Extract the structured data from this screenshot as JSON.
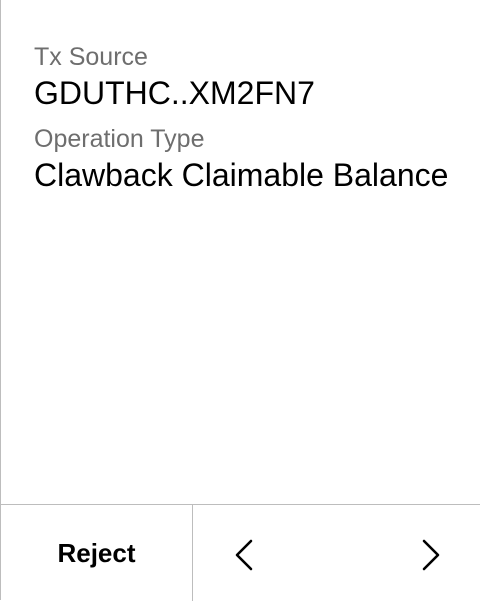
{
  "fields": [
    {
      "label": "Tx Source",
      "value": "GDUTHC..XM2FN7"
    },
    {
      "label": "Operation Type",
      "value": "Clawback Claimable Balance"
    }
  ],
  "footer": {
    "reject_label": "Reject",
    "prev_icon": "chevron-left-icon",
    "next_icon": "chevron-right-icon"
  }
}
